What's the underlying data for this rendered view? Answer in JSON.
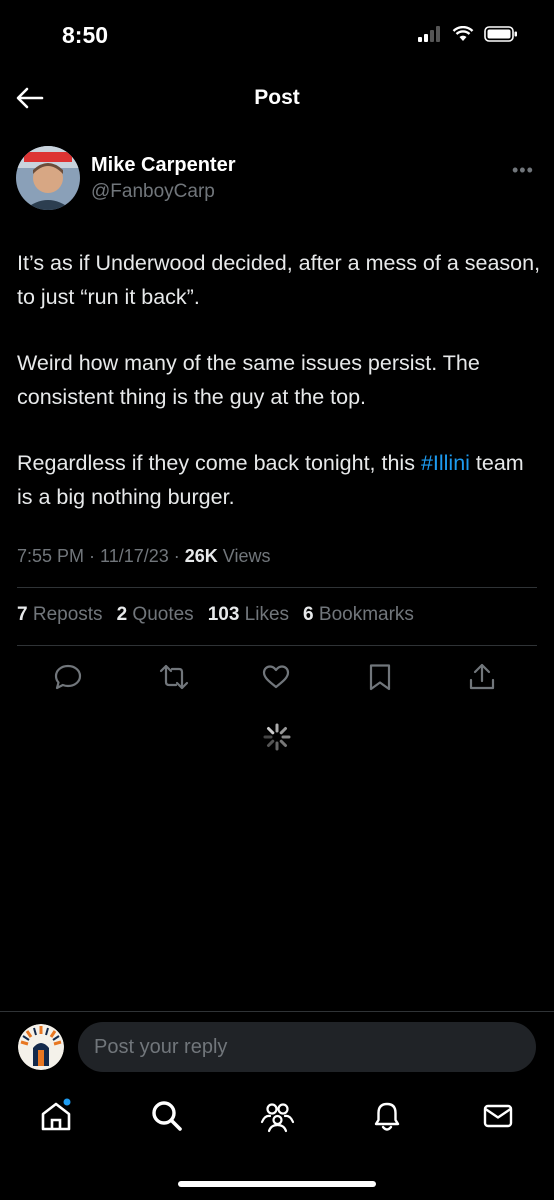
{
  "status_bar": {
    "time": "8:50"
  },
  "header": {
    "title": "Post"
  },
  "author": {
    "name": "Mike Carpenter",
    "handle": "@FanboyCarp"
  },
  "tweet": {
    "para1": "It’s as if Underwood decided, after a mess of a season, to just “run it back”.",
    "para2": "Weird how many of the same issues persist. The consistent thing is the guy at the top.",
    "para3_prefix": "Regardless if they come back tonight, this ",
    "para3_hashtag": "#Illini",
    "para3_suffix": " team is a big nothing burger."
  },
  "meta": {
    "time_date": "7:55 PM · 11/17/23 · ",
    "views_count": "26K",
    "views_label": " Views"
  },
  "stats": {
    "reposts_count": "7",
    "reposts_label": "Reposts",
    "quotes_count": "2",
    "quotes_label": "Quotes",
    "likes_count": "103",
    "likes_label": "Likes",
    "bookmarks_count": "6",
    "bookmarks_label": "Bookmarks"
  },
  "reply": {
    "placeholder": "Post your reply"
  },
  "colors": {
    "accent": "#1d9bf0",
    "muted": "#71767b",
    "background": "#000000"
  },
  "icons": [
    "arrow-left-icon",
    "more-icon",
    "reply-icon",
    "repost-icon",
    "like-icon",
    "bookmark-icon",
    "share-icon",
    "loading-spinner",
    "home-icon",
    "search-icon",
    "communities-icon",
    "notifications-icon",
    "messages-icon"
  ]
}
